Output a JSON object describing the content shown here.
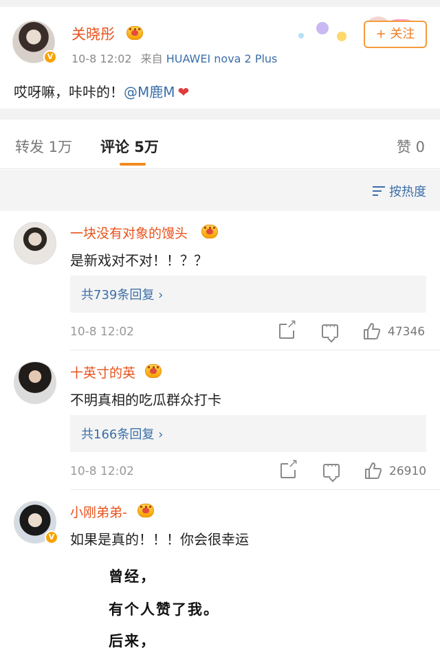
{
  "post": {
    "author": "关晓彤",
    "time": "10-8 12:02",
    "source_prefix": "来自",
    "device": "HUAWEI nova 2 Plus",
    "follow_label": "+ 关注",
    "text_before": "哎呀嘛，咔咔的！",
    "mention": "@M鹿M",
    "heart": "❤"
  },
  "tabs": {
    "repost": "转发 1万",
    "comments": "评论 5万",
    "likes": "赞 0"
  },
  "sort_label": "按热度",
  "comments": [
    {
      "name": "一块没有对象的馒头",
      "text": "是新戏对不对！！？？",
      "replies": "共739条回复 ›",
      "time": "10-8 12:02",
      "likes": "47346"
    },
    {
      "name": "十英寸的英",
      "text": "不明真相的吃瓜群众打卡",
      "replies": "共166条回复 ›",
      "time": "10-8 12:02",
      "likes": "26910"
    },
    {
      "name": "小刚弟弟-",
      "text": "如果是真的！！！你会很幸运"
    }
  ],
  "poem": [
    "曾经，",
    "有个人赞了我。",
    "后来，"
  ],
  "colors": {
    "username": "#e8521c",
    "link": "#3a6ea8",
    "accent": "#f28a1d",
    "verified": "#f7a200"
  }
}
